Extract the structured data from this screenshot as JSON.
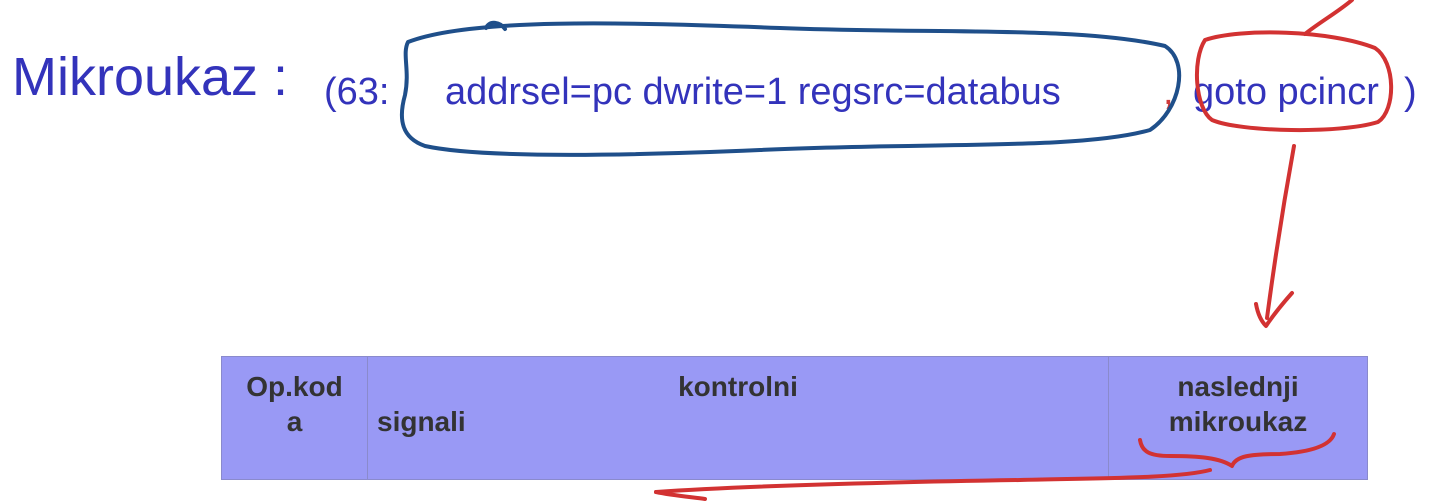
{
  "heading": {
    "label": "Mikroukaz :",
    "open": "(63:",
    "signals": "addrsel=pc  dwrite=1  regsrc=databus",
    "comma": ",",
    "next": "goto pcincr",
    "close": ")"
  },
  "table": {
    "opcode_line1": "Op.kod",
    "opcode_line2": "a",
    "signals_line1": "kontrolni",
    "signals_line2": "signali",
    "next_line1": "naslednji",
    "next_line2": "mikroukaz"
  },
  "colors": {
    "text_blue": "#3333bb",
    "table_fill": "#9999f5",
    "annotation_blue": "#1f4f8a",
    "annotation_red": "#d23232"
  }
}
